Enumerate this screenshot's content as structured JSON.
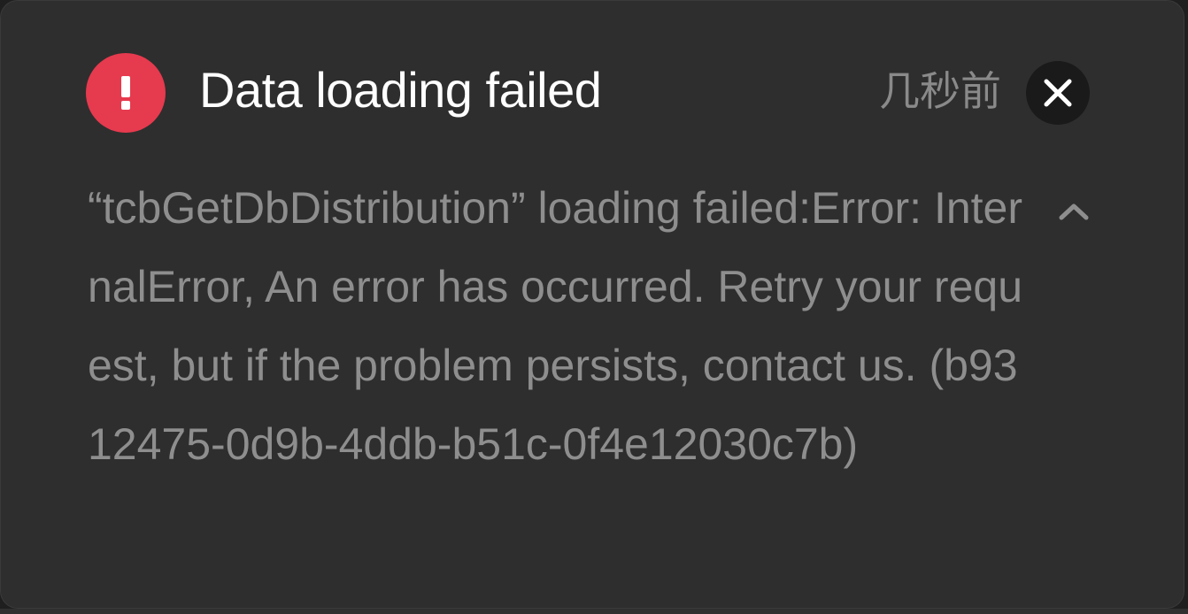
{
  "notification": {
    "title": "Data loading failed",
    "timestamp": "几秒前",
    "message": "“tcbGetDbDistribution” loading failed:Error: InternalError, An error has occurred. Retry your request, but if the problem persists, contact us. (b9312475-0d9b-4ddb-b51c-0f4e12030c7b)",
    "status_icon": "exclamation-circle-icon",
    "close_icon": "close-x-icon",
    "collapse_icon": "chevron-up-icon"
  },
  "colors": {
    "background": "#2e2e2e",
    "error_red": "#e63a4e",
    "title_text": "#ffffff",
    "secondary_text": "#8e8e8e",
    "close_button_bg": "#1a1a1a"
  }
}
